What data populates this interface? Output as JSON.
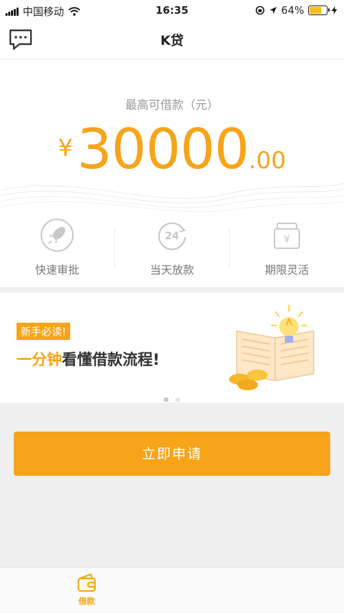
{
  "status_bar": {
    "carrier": "中国移动",
    "time": "16:35",
    "battery": "64%",
    "battery_level": 0.64
  },
  "nav": {
    "title": "K贷",
    "message_icon": "chat-bubble-icon"
  },
  "loan": {
    "label": "最高可借款（元）",
    "currency": "¥",
    "amount_int": "30000",
    "amount_dec": ".00"
  },
  "features": [
    {
      "label": "快速审批",
      "icon": "rocket-icon"
    },
    {
      "label": "当天放款",
      "icon": "24h-icon"
    },
    {
      "label": "期限灵活",
      "icon": "money-bag-icon"
    }
  ],
  "banner": {
    "tag": "新手必读!",
    "headline_highlight": "一分钟",
    "headline_rest": "看懂借款流程!",
    "dots_total": 2,
    "dots_active": 1
  },
  "apply_button": "立即申请",
  "tabbar": {
    "items": [
      {
        "label": "借款",
        "icon": "wallet-icon",
        "active": true
      }
    ]
  },
  "colors": {
    "accent": "#f6a41a",
    "background": "#efefef",
    "muted": "#9a9a9a"
  }
}
